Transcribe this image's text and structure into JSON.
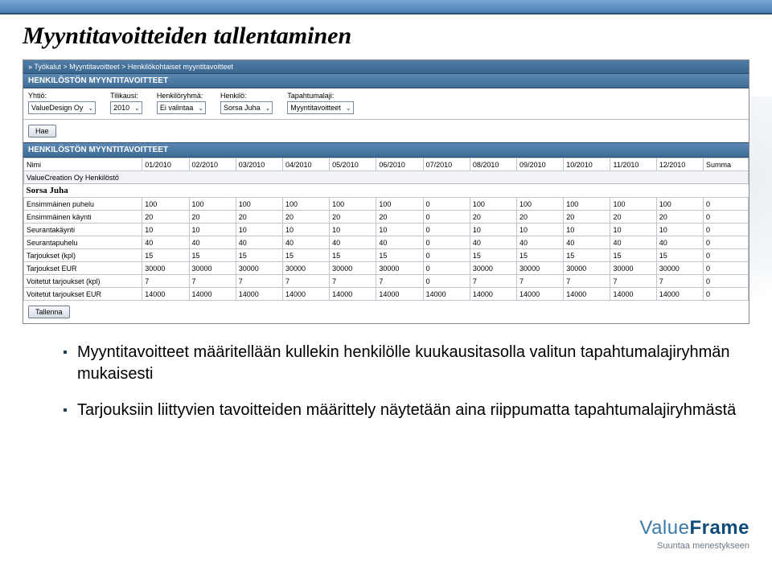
{
  "page_title": "Myyntitavoitteiden tallentaminen",
  "breadcrumb": "» Työkalut > Myyntitavoitteet > Henkilökohtaiset myyntitavoitteet",
  "section1_title": "HENKILÖSTÖN MYYNTITAVOITTEET",
  "section2_title": "HENKILÖSTÖN MYYNTITAVOITTEET",
  "filters": {
    "company": {
      "label": "Yhtiö:",
      "value": "ValueDesign Oy"
    },
    "fiscal": {
      "label": "Tilikausi:",
      "value": "2010"
    },
    "group": {
      "label": "Henkilöryhmä:",
      "value": "Ei valintaa"
    },
    "person": {
      "label": "Henkilö:",
      "value": "Sorsa Juha"
    },
    "eventtype": {
      "label": "Tapahtumalaji:",
      "value": "Myyntitavoitteet"
    }
  },
  "search_button": "Hae",
  "save_button": "Tallenna",
  "table": {
    "header_first": "Nimi",
    "months": [
      "01/2010",
      "02/2010",
      "03/2010",
      "04/2010",
      "05/2010",
      "06/2010",
      "07/2010",
      "08/2010",
      "09/2010",
      "10/2010",
      "11/2010",
      "12/2010"
    ],
    "sum_label": "Summa",
    "subheader": "ValueCreation Oy Henkilöstö",
    "person": "Sorsa Juha",
    "rows": [
      {
        "label": "Ensimmäinen puhelu",
        "v": [
          "100",
          "100",
          "100",
          "100",
          "100",
          "100",
          "0",
          "100",
          "100",
          "100",
          "100",
          "100"
        ],
        "sum": "0"
      },
      {
        "label": "Ensimmäinen käynti",
        "v": [
          "20",
          "20",
          "20",
          "20",
          "20",
          "20",
          "0",
          "20",
          "20",
          "20",
          "20",
          "20"
        ],
        "sum": "0"
      },
      {
        "label": "Seurantakäynti",
        "v": [
          "10",
          "10",
          "10",
          "10",
          "10",
          "10",
          "0",
          "10",
          "10",
          "10",
          "10",
          "10"
        ],
        "sum": "0"
      },
      {
        "label": "Seurantapuhelu",
        "v": [
          "40",
          "40",
          "40",
          "40",
          "40",
          "40",
          "0",
          "40",
          "40",
          "40",
          "40",
          "40"
        ],
        "sum": "0"
      },
      {
        "label": "Tarjoukset (kpl)",
        "v": [
          "15",
          "15",
          "15",
          "15",
          "15",
          "15",
          "0",
          "15",
          "15",
          "15",
          "15",
          "15"
        ],
        "sum": "0"
      },
      {
        "label": "Tarjoukset EUR",
        "v": [
          "30000",
          "30000",
          "30000",
          "30000",
          "30000",
          "30000",
          "0",
          "30000",
          "30000",
          "30000",
          "30000",
          "30000"
        ],
        "sum": "0"
      },
      {
        "label": "Voitetut tarjoukset (kpl)",
        "v": [
          "7",
          "7",
          "7",
          "7",
          "7",
          "7",
          "0",
          "7",
          "7",
          "7",
          "7",
          "7"
        ],
        "sum": "0"
      },
      {
        "label": "Voitetut tarjoukset EUR",
        "v": [
          "14000",
          "14000",
          "14000",
          "14000",
          "14000",
          "14000",
          "14000",
          "14000",
          "14000",
          "14000",
          "14000",
          "14000"
        ],
        "sum": "0"
      }
    ]
  },
  "bullets": [
    "Myyntitavoitteet määritellään kullekin henkilölle kuukausitasolla valitun tapahtumalajiryhmän mukaisesti",
    "Tarjouksiin liittyvien tavoitteiden määrittely näytetään aina riippumatta tapahtumalajiryhmästä"
  ],
  "brand": {
    "part1": "Value",
    "part2": "Frame",
    "tagline": "Suuntaa menestykseen"
  }
}
